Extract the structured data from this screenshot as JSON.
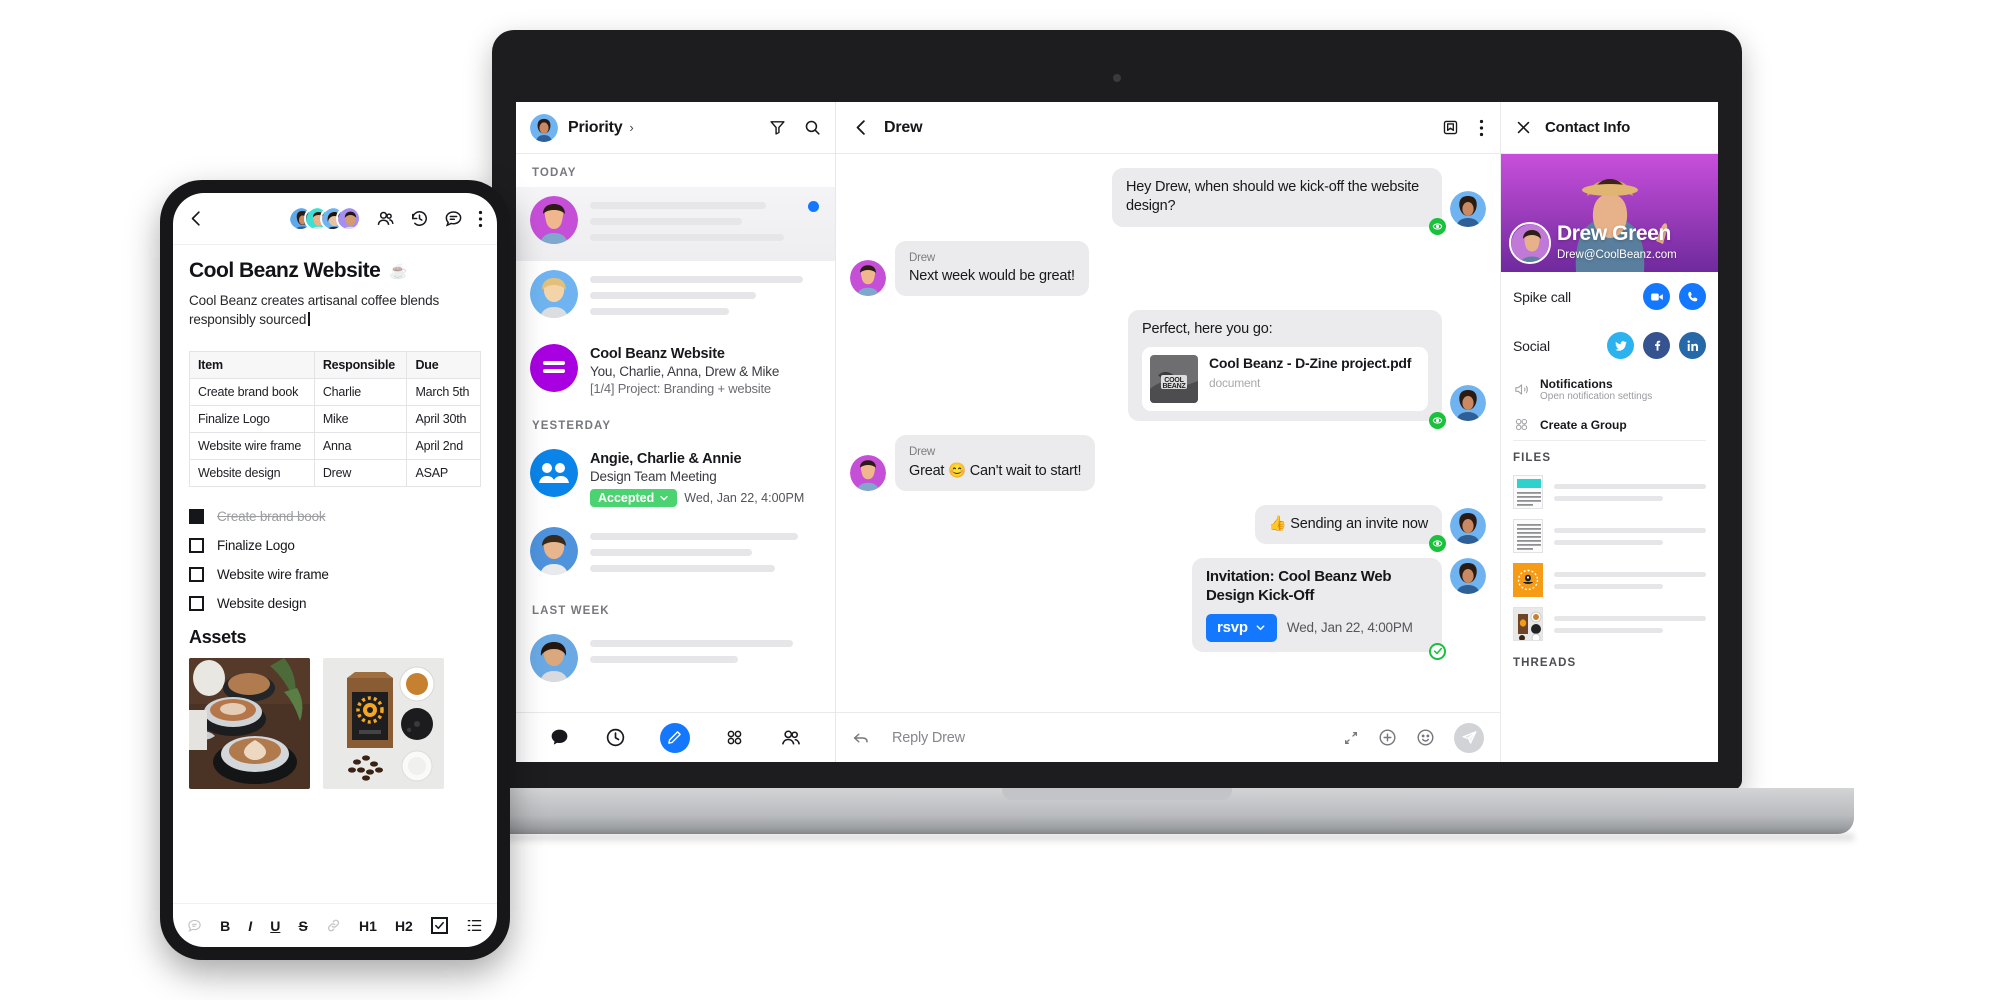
{
  "laptop": {
    "sidebar": {
      "header": {
        "title": "Priority",
        "chevron": "›",
        "filter_icon": "filter-icon",
        "search_icon": "search-icon"
      },
      "sections": [
        {
          "label": "TODAY",
          "rows": [
            {
              "type": "placeholder",
              "selected": true,
              "unread": true,
              "avatar": "avatar-drew"
            },
            {
              "type": "placeholder",
              "selected": false,
              "unread": false,
              "avatar": "avatar-woman-blonde"
            },
            {
              "type": "detail",
              "title": "Cool Beanz Website",
              "subtitle": "You, Charlie, Anna, Drew & Mike",
              "meta": "[1/4] Project: Branding + website",
              "avatar": "avatar-group-purple"
            }
          ]
        },
        {
          "label": "YESTERDAY",
          "rows": [
            {
              "type": "meeting",
              "title": "Angie, Charlie & Annie",
              "subtitle": "Design Team Meeting",
              "badge": "Accepted",
              "time": "Wed, Jan 22, 4:00PM",
              "avatar": "avatar-group-blue"
            },
            {
              "type": "placeholder",
              "selected": false,
              "unread": false,
              "avatar": "avatar-man-blue"
            }
          ]
        },
        {
          "label": "LAST WEEK",
          "rows": [
            {
              "type": "placeholder",
              "selected": false,
              "unread": false,
              "avatar": "avatar-woman-blue"
            }
          ]
        }
      ],
      "nav": [
        {
          "name": "chat-icon"
        },
        {
          "name": "clock-icon"
        },
        {
          "name": "compose-icon",
          "active": true
        },
        {
          "name": "apps-icon"
        },
        {
          "name": "people-icon"
        }
      ]
    },
    "chat": {
      "header": {
        "back_icon": "back-chevron-icon",
        "title": "Drew",
        "archive_icon": "archive-icon",
        "more_icon": "more-vertical-icon"
      },
      "messages": [
        {
          "dir": "out",
          "text": "Hey Drew, when should we kick-off the website design?",
          "status": "seen"
        },
        {
          "dir": "in",
          "sender": "Drew",
          "text": "Next week would be great!"
        },
        {
          "dir": "out",
          "text": "Perfect, here you go:",
          "attachment": {
            "name": "Cool Beanz - D-Zine project.pdf",
            "type": "document"
          },
          "status": "seen"
        },
        {
          "dir": "in",
          "sender": "Drew",
          "text": "Great 😊 Can't wait to start!"
        },
        {
          "dir": "out",
          "text": "👍 Sending an invite now",
          "status": "seen"
        },
        {
          "dir": "out",
          "invitation": {
            "title": "Invitation: Cool Beanz Web Design Kick-Off",
            "rsvp_label": "rsvp",
            "time": "Wed, Jan 22, 4:00PM"
          },
          "status": "sent"
        }
      ],
      "reply": {
        "reply_icon": "reply-arrow-icon",
        "placeholder": "Reply Drew",
        "expand_icon": "expand-icon",
        "attach_icon": "plus-circle-icon",
        "emoji_icon": "emoji-icon",
        "send_icon": "send-icon"
      }
    },
    "info": {
      "header": {
        "close_icon": "close-icon",
        "title": "Contact Info"
      },
      "hero": {
        "name": "Drew Green",
        "email": "Drew@CoolBeanz.com"
      },
      "rows": [
        {
          "label": "Spike call",
          "actions": [
            {
              "name": "video-call-icon",
              "color": "#1478ff"
            },
            {
              "name": "phone-call-icon",
              "color": "#1478ff"
            }
          ]
        },
        {
          "label": "Social",
          "actions": [
            {
              "name": "twitter-icon",
              "color": "#2bb2ef"
            },
            {
              "name": "facebook-icon",
              "color": "#35538f"
            },
            {
              "name": "linkedin-icon",
              "color": "#2768a8"
            }
          ]
        }
      ],
      "options": [
        {
          "icon": "speaker-icon",
          "title": "Notifications",
          "subtitle": "Open notification settings"
        },
        {
          "icon": "group-icon",
          "title": "Create a Group",
          "subtitle": ""
        }
      ],
      "files_label": "FILES",
      "files": [
        {
          "thumb": "doc-teal-thumb"
        },
        {
          "thumb": "doc-lines-thumb"
        },
        {
          "thumb": "coffee-logo-thumb"
        },
        {
          "thumb": "coffee-photo-thumb"
        }
      ],
      "threads_label": "THREADS"
    }
  },
  "phone": {
    "header": {
      "back_icon": "back-chevron-icon",
      "avatars": [
        "avatar-1",
        "avatar-2",
        "avatar-3",
        "avatar-4"
      ],
      "icons": [
        "people-icon",
        "history-icon",
        "comment-icon",
        "more-vertical-icon"
      ]
    },
    "title": "Cool Beanz Website",
    "title_emoji": "☕",
    "description": "Cool Beanz creates artisanal coffee blends responsibly sourced",
    "table": {
      "headers": [
        "Item",
        "Responsible",
        "Due"
      ],
      "rows": [
        [
          "Create brand book",
          "Charlie",
          "March 5th"
        ],
        [
          "Finalize Logo",
          "Mike",
          "April 30th"
        ],
        [
          "Website wire frame",
          "Anna",
          "April 2nd"
        ],
        [
          "Website design",
          "Drew",
          "ASAP"
        ]
      ]
    },
    "checklist": [
      {
        "label": "Create brand book",
        "done": true
      },
      {
        "label": "Finalize Logo",
        "done": false
      },
      {
        "label": "Website wire frame",
        "done": false
      },
      {
        "label": "Website design",
        "done": false
      }
    ],
    "assets_label": "Assets",
    "assets": [
      {
        "name": "latte-art-photo"
      },
      {
        "name": "coffee-packaging-photo"
      }
    ],
    "toolbar": [
      {
        "name": "comment-icon",
        "label": "",
        "muted": true
      },
      {
        "name": "bold-icon",
        "label": "B"
      },
      {
        "name": "italic-icon",
        "label": "I"
      },
      {
        "name": "underline-icon",
        "label": "U"
      },
      {
        "name": "strikethrough-icon",
        "label": "S"
      },
      {
        "name": "link-icon",
        "label": "",
        "muted": true
      },
      {
        "name": "heading1-icon",
        "label": "H1"
      },
      {
        "name": "heading2-icon",
        "label": "H2"
      },
      {
        "name": "checkbox-icon",
        "label": ""
      },
      {
        "name": "list-icon",
        "label": ""
      }
    ]
  }
}
